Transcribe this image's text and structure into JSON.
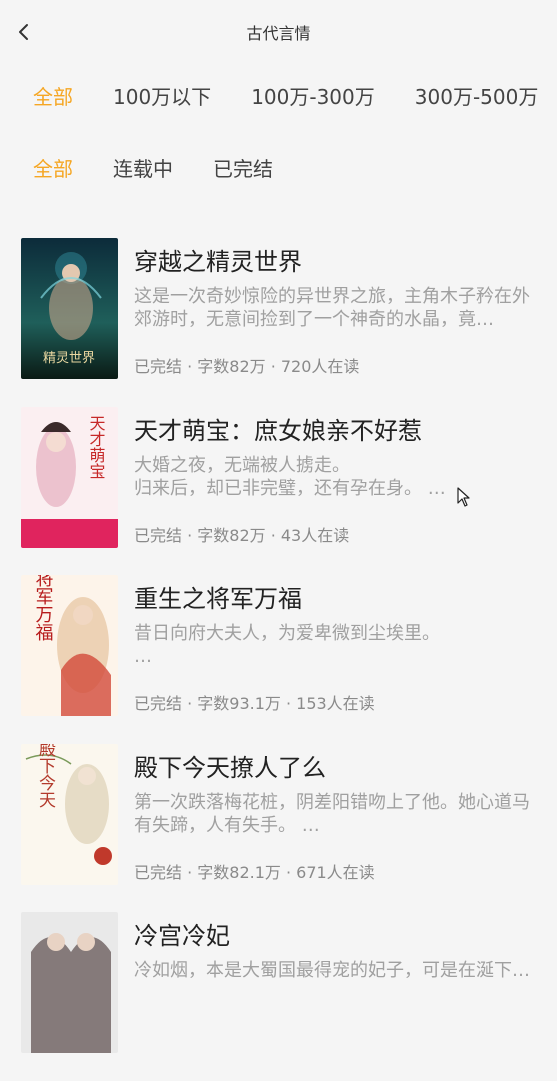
{
  "header": {
    "title": "古代言情"
  },
  "filters": {
    "word_count": [
      "全部",
      "100万以下",
      "100万-300万",
      "300万-500万"
    ],
    "status": [
      "全部",
      "连载中",
      "已完结"
    ]
  },
  "books": [
    {
      "title": "穿越之精灵世界",
      "desc": "这是一次奇妙惊险的异世界之旅，主角木子矜在外郊游时，无意间捡到了一个神奇的水晶，竟…",
      "meta": "已完结 · 字数82万 · 720人在读",
      "cover_text": "精灵世界",
      "cover_colors": [
        "#0c2b3a",
        "#1f5f5a",
        "#c9b27a"
      ]
    },
    {
      "title": "天才萌宝：庶女娘亲不好惹",
      "desc": "大婚之夜，无端被人掳走。\n归来后，却已非完璧，还有孕在身。  …",
      "meta": "已完结 · 字数82万 · 43人在读",
      "cover_text": "天才萌宝",
      "cover_colors": [
        "#fbeff1",
        "#e8b6c5",
        "#e0245e"
      ]
    },
    {
      "title": "重生之将军万福",
      "desc": "昔日向府大夫人，为爱卑微到尘埃里。\n…",
      "meta": "已完结 · 字数93.1万 · 153人在读",
      "cover_text": "将军万福",
      "cover_colors": [
        "#fdf4ea",
        "#e9c9a8",
        "#c0272d"
      ]
    },
    {
      "title": "殿下今天撩人了么",
      "desc": "第一次跌落梅花桩，阴差阳错吻上了他。她心道马有失蹄，人有失手。 …",
      "meta": "已完结 · 字数82.1万 · 671人在读",
      "cover_text": "殿下今天",
      "cover_colors": [
        "#fbf7ee",
        "#e6dcc6",
        "#b33a2c"
      ]
    },
    {
      "title": "冷宫冷妃",
      "desc": "冷如烟，本是大蜀国最得宠的妃子，可是在涎下…",
      "meta": "",
      "cover_text": "",
      "cover_colors": [
        "#e9e9e9",
        "#5a4a4a",
        "#2a2a2a"
      ]
    }
  ]
}
